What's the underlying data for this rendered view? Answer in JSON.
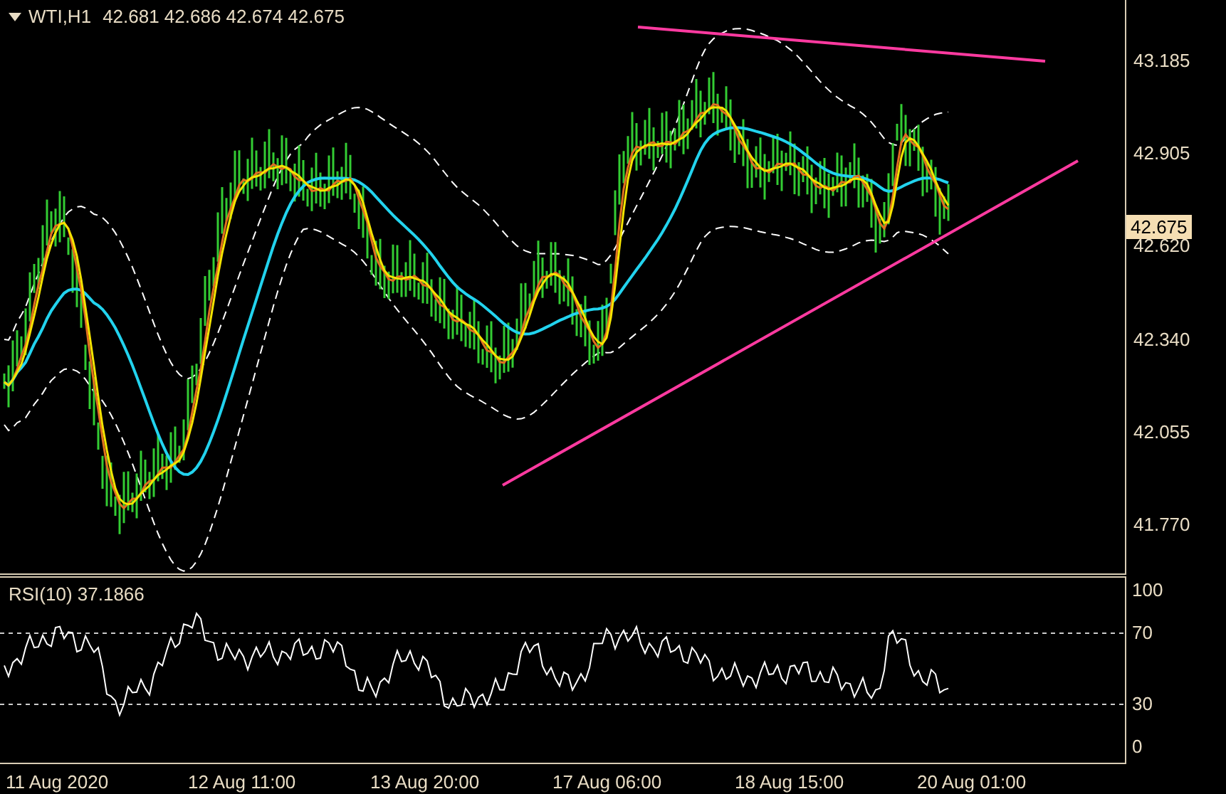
{
  "header": {
    "symbol": "WTI,H1",
    "ohlc": "42.681 42.686 42.674 42.675"
  },
  "price_axis": [
    "43.185",
    "42.905",
    "42.620",
    "42.340",
    "42.055",
    "41.770"
  ],
  "current_price": "42.675",
  "rsi": {
    "label": "RSI(10) 37.1866",
    "axis": [
      "100",
      "70",
      "30",
      "0"
    ]
  },
  "time_axis": [
    "11 Aug 2020",
    "12 Aug 11:00",
    "13 Aug 20:00",
    "17 Aug 06:00",
    "18 Aug 15:00",
    "20 Aug 01:00"
  ]
}
